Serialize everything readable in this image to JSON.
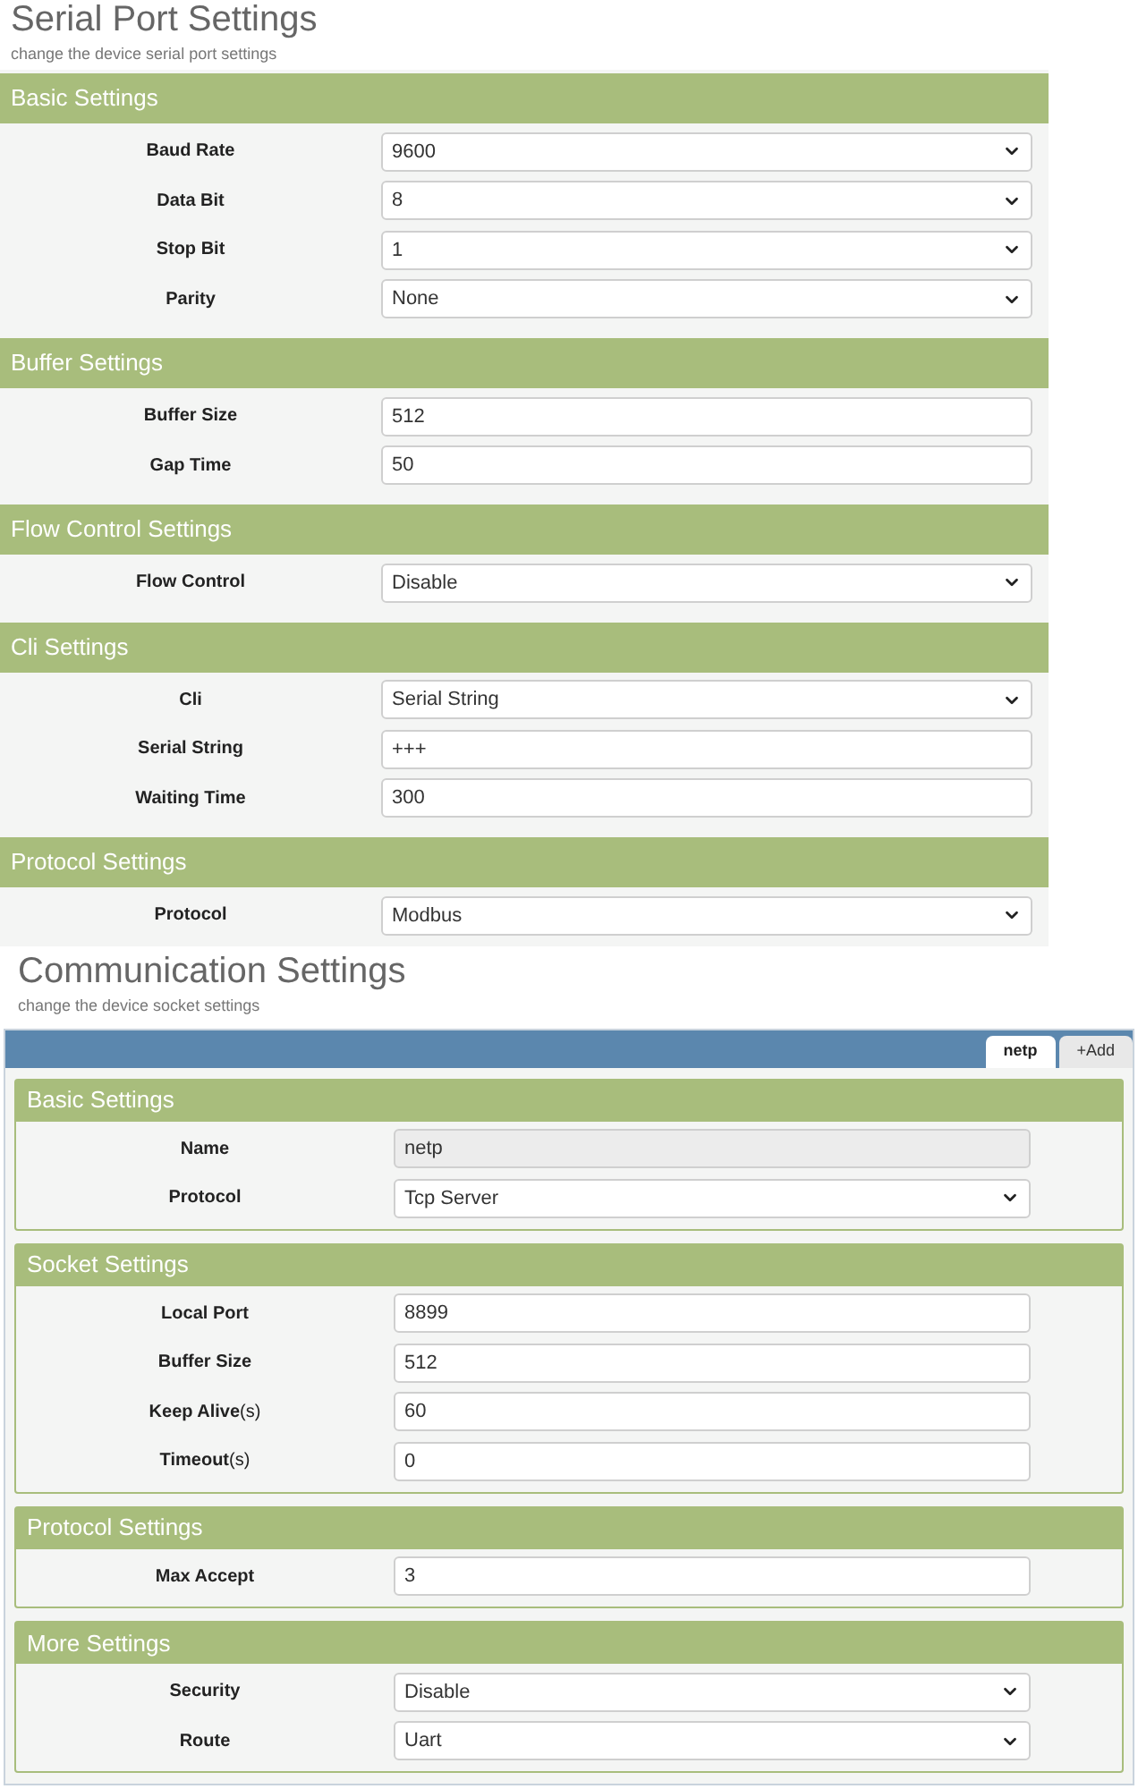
{
  "serial": {
    "title": "Serial Port Settings",
    "subtitle": "change the device serial port settings",
    "sections": [
      {
        "title": "Basic Settings",
        "fields": [
          {
            "label": "Baud Rate",
            "kind": "select",
            "value": "9600",
            "disabled": false
          },
          {
            "label": "Data Bit",
            "kind": "select",
            "value": "8",
            "disabled": false
          },
          {
            "label": "Stop Bit",
            "kind": "select",
            "value": "1",
            "disabled": false
          },
          {
            "label": "Parity",
            "kind": "select",
            "value": "None",
            "disabled": false
          }
        ]
      },
      {
        "title": "Buffer Settings",
        "fields": [
          {
            "label": "Buffer Size",
            "kind": "text",
            "value": "512",
            "disabled": false
          },
          {
            "label": "Gap Time",
            "kind": "text",
            "value": "50",
            "disabled": false
          }
        ]
      },
      {
        "title": "Flow Control Settings",
        "fields": [
          {
            "label": "Flow Control",
            "kind": "select",
            "value": "Disable",
            "disabled": false
          }
        ]
      },
      {
        "title": "Cli Settings",
        "fields": [
          {
            "label": "Cli",
            "kind": "select",
            "value": "Serial String",
            "disabled": false
          },
          {
            "label": "Serial String",
            "kind": "text",
            "value": "+++",
            "disabled": false
          },
          {
            "label": "Waiting Time",
            "kind": "text",
            "value": "300",
            "disabled": false
          }
        ]
      },
      {
        "title": "Protocol Settings",
        "fields": [
          {
            "label": "Protocol",
            "kind": "select",
            "value": "Modbus",
            "disabled": false
          }
        ]
      }
    ]
  },
  "communication": {
    "title": "Communication Settings",
    "subtitle": "change the device socket settings",
    "tabs": [
      {
        "label": "netp",
        "selected": true
      },
      {
        "label": "+Add",
        "selected": false
      }
    ],
    "sections": [
      {
        "title": "Basic Settings",
        "fields": [
          {
            "label": "Name",
            "kind": "text",
            "value": "netp",
            "disabled": true
          },
          {
            "label": "Protocol",
            "kind": "select",
            "value": "Tcp Server",
            "disabled": false
          }
        ]
      },
      {
        "title": "Socket Settings",
        "fields": [
          {
            "label": "Local Port",
            "kind": "text",
            "value": "8899",
            "disabled": false
          },
          {
            "label": "Buffer Size",
            "kind": "text",
            "value": "512",
            "disabled": false
          },
          {
            "label": "Keep Alive",
            "unit": "(s)",
            "kind": "text",
            "value": "60",
            "disabled": false
          },
          {
            "label": "Timeout",
            "unit": "(s)",
            "kind": "text",
            "value": "0",
            "disabled": false
          }
        ]
      },
      {
        "title": "Protocol Settings",
        "fields": [
          {
            "label": "Max Accept",
            "kind": "text",
            "value": "3",
            "disabled": false
          }
        ]
      },
      {
        "title": "More Settings",
        "fields": [
          {
            "label": "Security",
            "kind": "select",
            "value": "Disable",
            "disabled": false
          },
          {
            "label": "Route",
            "kind": "select",
            "value": "Uart",
            "disabled": false
          }
        ]
      }
    ]
  }
}
